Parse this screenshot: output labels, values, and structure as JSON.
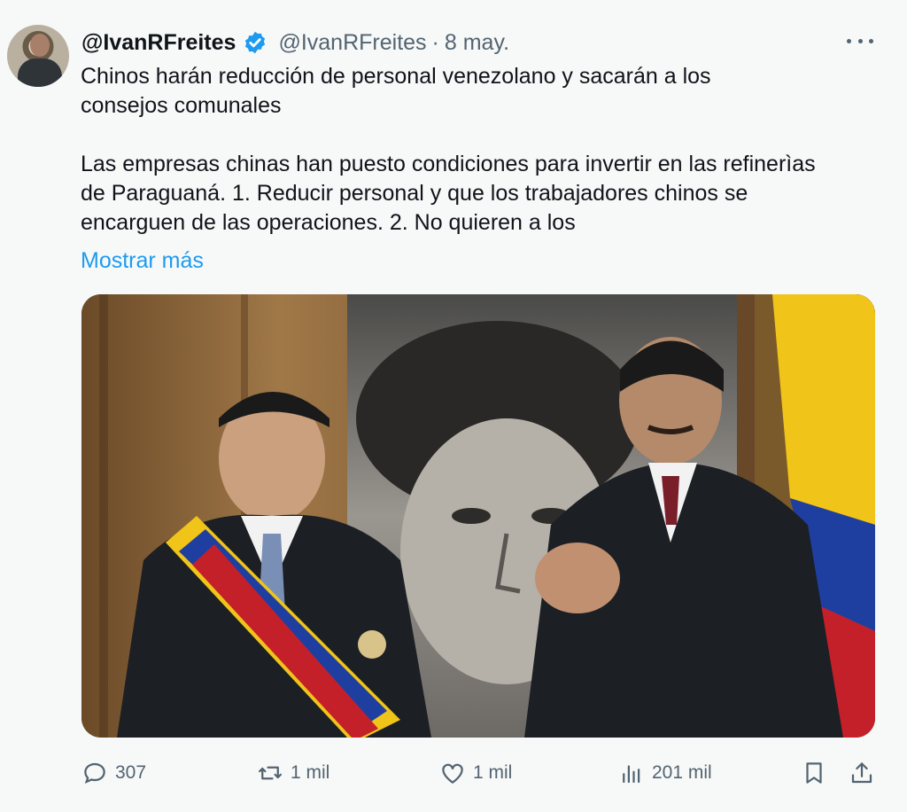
{
  "author": {
    "display_name": "@IvanRFreites",
    "handle": "@IvanRFreites",
    "separator": "·",
    "date": "8 may.",
    "verified": true
  },
  "tweet": {
    "body": "Chinos harán reducción de personal venezolano y sacarán a los\nconsejos comunales\n\nLas empresas chinas han puesto condiciones para invertir en las  refinerìas\nde Paraguaná. 1. Reducir personal y que los trabajadores chinos se\nencarguen de las operaciones. 2. No quieren a los",
    "show_more": "Mostrar más"
  },
  "metrics": {
    "replies": "307",
    "retweets": "1 mil",
    "likes": "1 mil",
    "views": "201 mil"
  },
  "icons": {
    "reply": "reply-icon",
    "retweet": "retweet-icon",
    "like": "heart-icon",
    "views": "views-icon",
    "bookmark": "bookmark-icon",
    "share": "share-icon",
    "more": "more-icon",
    "verified": "verified-badge-icon"
  },
  "colors": {
    "link": "#1d9bf0",
    "muted": "#536471",
    "verified": "#1d9bf0",
    "background": "#f7f8f8"
  }
}
